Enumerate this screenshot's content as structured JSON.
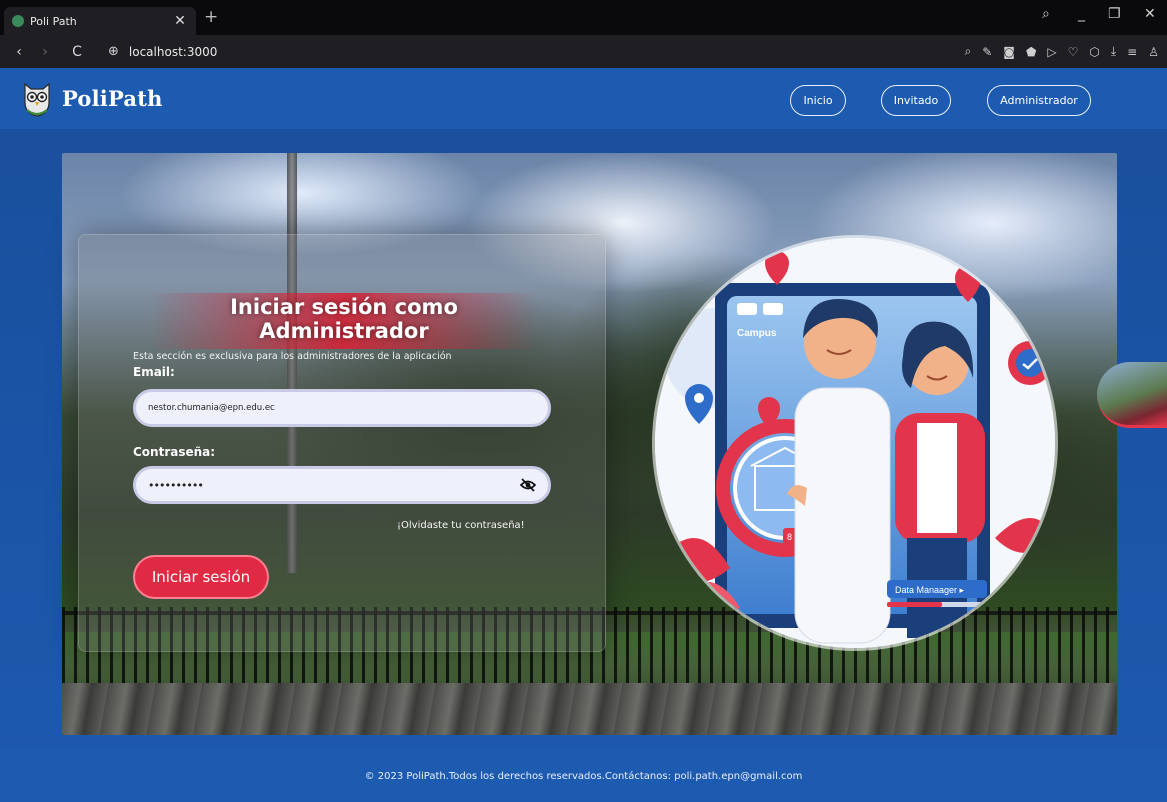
{
  "browser": {
    "tab_title": "Poli Path",
    "tab_close": "✕",
    "new_tab": "+",
    "url": "localhost:3000",
    "win_min": "_",
    "win_restore": "❐",
    "win_close": "✕"
  },
  "navbar": {
    "brand": "PoliPath",
    "links": [
      "Inicio",
      "Invitado",
      "Administrador"
    ]
  },
  "login": {
    "title": "Iniciar sesión como Administrador",
    "subtitle": "Esta sección es exclusiva para los administradores de la aplicación",
    "email_label": "Email:",
    "email_value": "nestor.chumania@epn.edu.ec",
    "password_label": "Contraseña:",
    "password_value": "••••••••••",
    "forgot": "¡Olvidaste tu contraseña!",
    "submit": "Iniciar sesión"
  },
  "illustration": {
    "campus_label": "Campus",
    "badge_label": "Data Manaager ▸",
    "pin_number": "8"
  },
  "footer": {
    "text": "© 2023 PoliPath.Todos los derechos reservados.Contáctanos: poli.path.epn@gmail.com"
  },
  "colors": {
    "accent": "#e02a44",
    "nav_blue": "#1d5bb0",
    "input_bg": "#eef1fb"
  }
}
